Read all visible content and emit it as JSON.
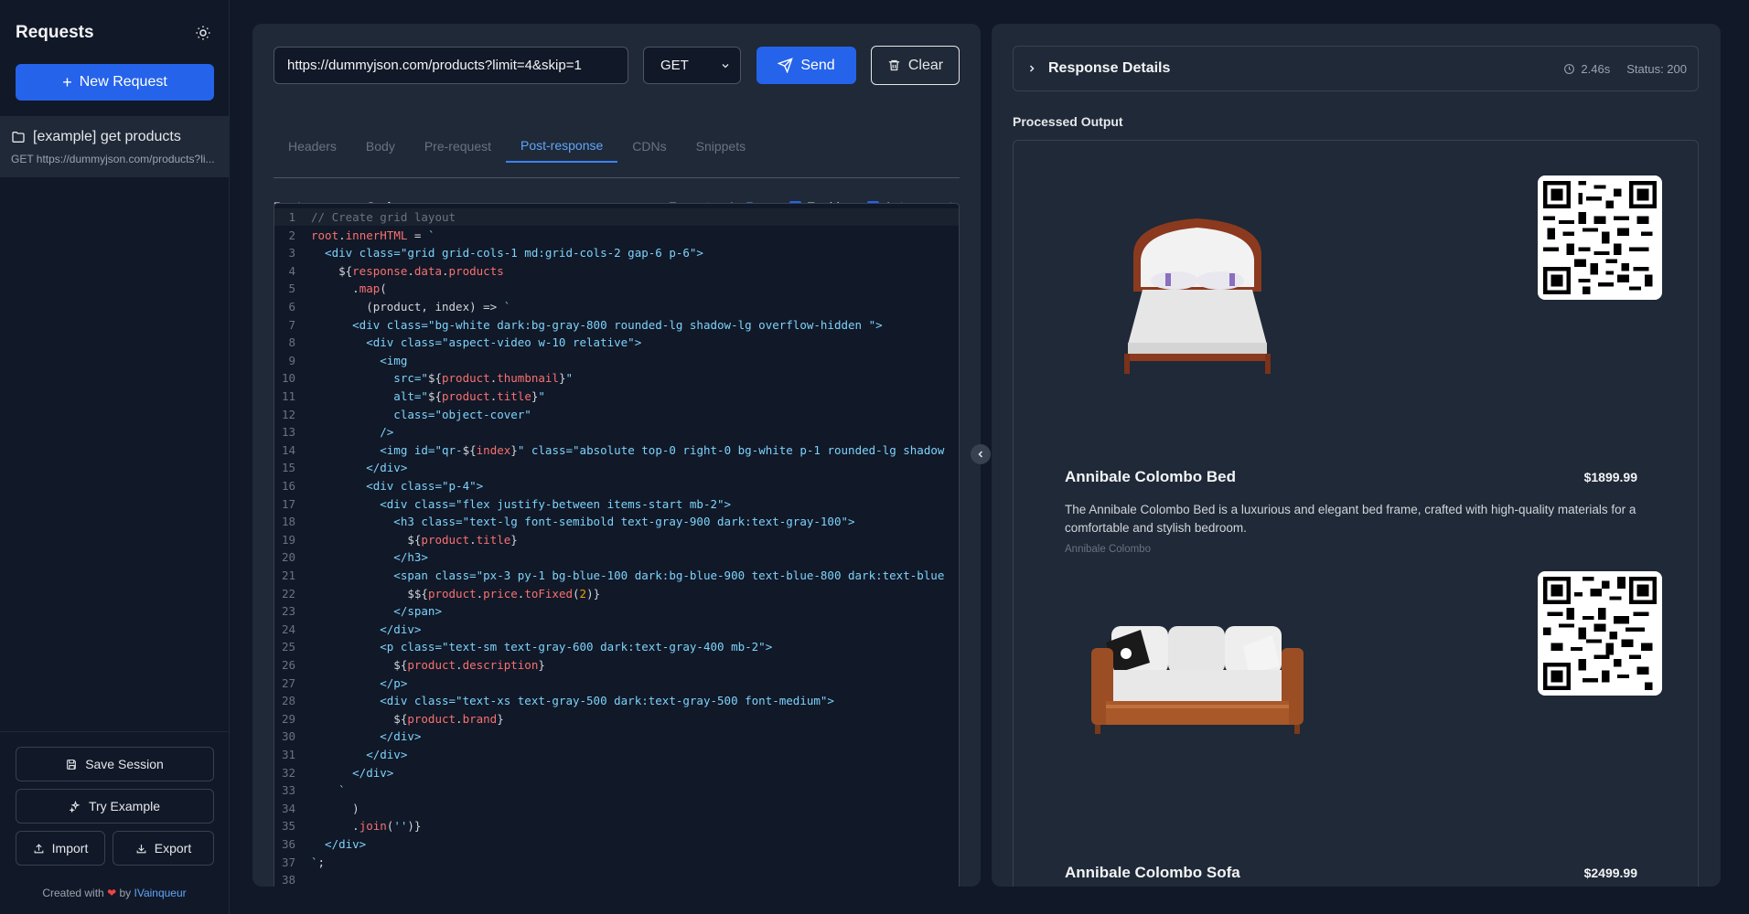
{
  "sidebar": {
    "title": "Requests",
    "new_request": "New Request",
    "items": [
      {
        "name": "[example] get products",
        "subtitle": "GET https://dummyjson.com/products?li..."
      }
    ],
    "save_session": "Save Session",
    "try_example": "Try Example",
    "import": "Import",
    "export": "Export",
    "credits_prefix": "Created with",
    "credits_by": "by",
    "credits_author": "IVainqueur"
  },
  "request": {
    "url": "https://dummyjson.com/products?limit=4&skip=1",
    "method": "GET",
    "send": "Send",
    "clear": "Clear",
    "tabs": [
      "Headers",
      "Body",
      "Pre-request",
      "Post-response",
      "CDNs",
      "Snippets"
    ],
    "active_tab": "Post-response"
  },
  "editor": {
    "title": "Post-response Code",
    "format": "Format",
    "run": "Run",
    "enable": "Enable",
    "auto_execute": "Auto-execute"
  },
  "response": {
    "details_label": "Response Details",
    "time": "2.46s",
    "status": "Status: 200",
    "processed_label": "Processed Output",
    "products": [
      {
        "title": "Annibale Colombo Bed",
        "price": "$1899.99",
        "description": "The Annibale Colombo Bed is a luxurious and elegant bed frame, crafted with high-quality materials for a comfortable and stylish bedroom.",
        "brand": "Annibale Colombo"
      },
      {
        "title": "Annibale Colombo Sofa",
        "price": "$2499.99",
        "description": "",
        "brand": ""
      }
    ]
  },
  "colors": {
    "accent": "#2563eb",
    "panel": "#1f2937",
    "bg": "#111827"
  }
}
